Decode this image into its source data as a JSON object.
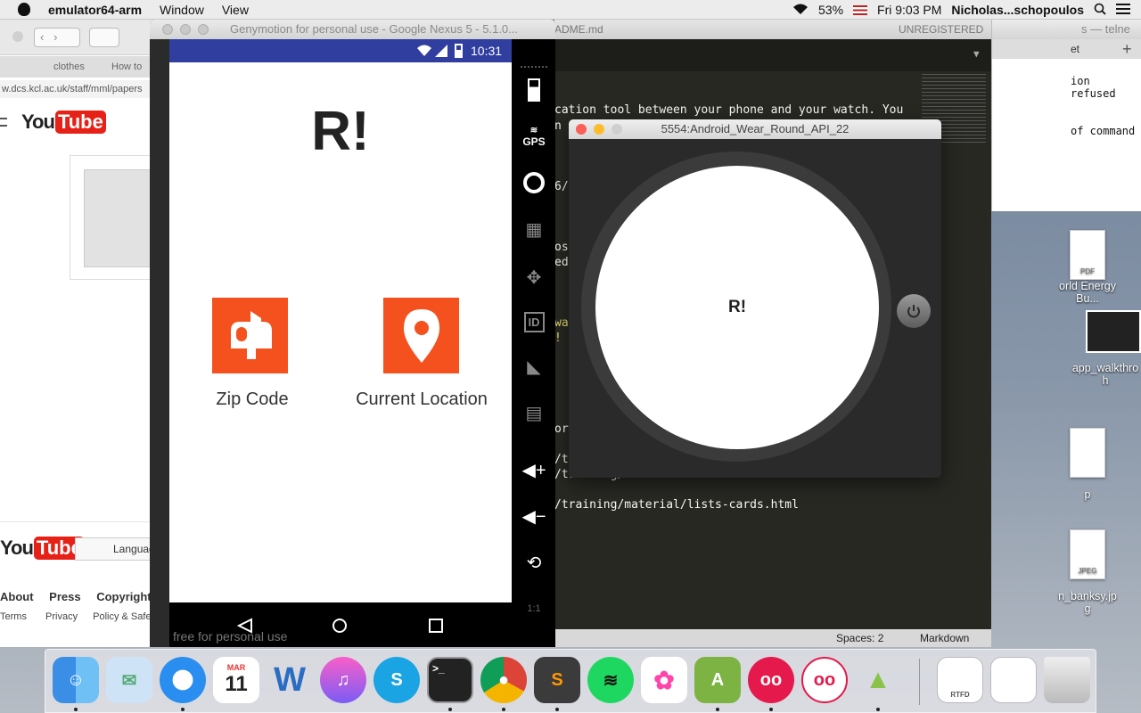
{
  "menubar": {
    "app_name": "emulator64-arm",
    "items": [
      "Window",
      "View"
    ],
    "battery": "53%",
    "datetime": "Fri 9:03 PM",
    "user": "Nicholas...schopoulos"
  },
  "browser": {
    "tab_clothes": "clothes",
    "tab_howto": "How to",
    "url": "w.dcs.kcl.ac.uk/staff/mml/papers",
    "yt_you": "You",
    "yt_tube": "Tube",
    "language_label": "Languag",
    "footer_row1": [
      "About",
      "Press",
      "Copyright"
    ],
    "footer_row2": [
      "Terms",
      "Privacy",
      "Policy & Safet"
    ]
  },
  "emulator": {
    "window_title": "Genymotion for personal use - Google Nexus 5 - 5.1.0...",
    "status_time": "10:31",
    "app_title": "R!",
    "buttons": [
      {
        "label": "Zip Code",
        "icon": "mailbox-icon"
      },
      {
        "label": "Current Location",
        "icon": "location-pin-icon"
      }
    ],
    "sidebar_gps": "GPS",
    "sidebar_id": "ID",
    "sidebar_ratio": "1:1",
    "watermark": "free for personal use"
  },
  "editor": {
    "title_partial": "ADME.md",
    "unregistered": "UNREGISTERED",
    "lines": {
      "l1": "cation tool between your phone and your watch. You",
      "l2": "n",
      "l3": "6/",
      "l4": "os",
      "l5": "ed",
      "l6": "wa",
      "l7": "! (",
      "l8": "or",
      "l9": "/t",
      "l10": "/training/...",
      "l11": "/training/material/lists-cards.html"
    },
    "status_spaces": "Spaces: 2",
    "status_syntax": "Markdown"
  },
  "wear": {
    "window_title": "5554:Android_Wear_Round_API_22",
    "face_text": "R!"
  },
  "terminal": {
    "title": "s — telne",
    "tab_partial": "et",
    "line1": "ion refused",
    "line2": "of command"
  },
  "desktop": {
    "pdf_badge": "PDF",
    "pdf_name_1": "orld Energy",
    "pdf_name_2": "Bu...",
    "walkthrough_1": "app_walkthro",
    "walkthrough_2": "h",
    "file_p": "p",
    "jpeg_badge": "JPEG",
    "jpeg_name_1": "n_banksy.jp",
    "jpeg_name_2": "g"
  },
  "dock": {
    "calendar_month": "MAR",
    "calendar_day": "11",
    "rtfd_badge": "RTFD",
    "apps": [
      "Finder",
      "Mail",
      "Safari",
      "Calendar",
      "Word",
      "iTunes",
      "Skype",
      "Terminal",
      "Chrome",
      "Sublime Text",
      "Spotify",
      "Photos",
      "Android Studio",
      "Genymotion",
      "Genymotion Shell",
      "Android",
      "RTFD",
      "Document",
      "Trash"
    ]
  },
  "colors": {
    "accent_orange": "#f4511e",
    "statusbar_blue": "#303f9f",
    "editor_bg": "#272822"
  }
}
